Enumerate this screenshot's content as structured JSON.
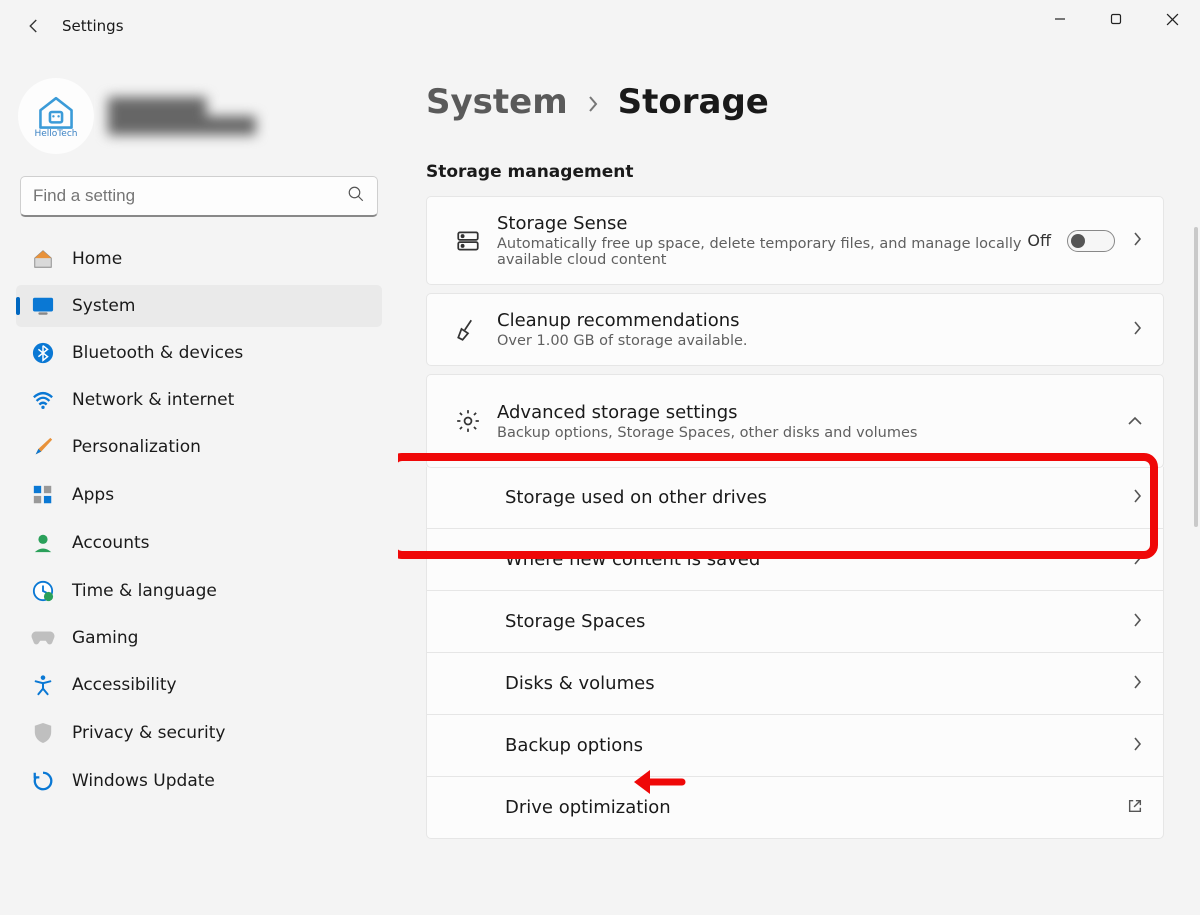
{
  "app": {
    "title": "Settings"
  },
  "profile": {
    "avatar_caption": "HelloTech"
  },
  "search": {
    "placeholder": "Find a setting"
  },
  "sidebar": {
    "items": [
      {
        "id": "home",
        "label": "Home"
      },
      {
        "id": "system",
        "label": "System",
        "active": true
      },
      {
        "id": "bluetooth",
        "label": "Bluetooth & devices"
      },
      {
        "id": "network",
        "label": "Network & internet"
      },
      {
        "id": "personalization",
        "label": "Personalization"
      },
      {
        "id": "apps",
        "label": "Apps"
      },
      {
        "id": "accounts",
        "label": "Accounts"
      },
      {
        "id": "time",
        "label": "Time & language"
      },
      {
        "id": "gaming",
        "label": "Gaming"
      },
      {
        "id": "accessibility",
        "label": "Accessibility"
      },
      {
        "id": "privacy",
        "label": "Privacy & security"
      },
      {
        "id": "update",
        "label": "Windows Update"
      }
    ]
  },
  "breadcrumb": {
    "parent": "System",
    "current": "Storage"
  },
  "main": {
    "section_label": "Storage management",
    "storage_sense": {
      "title": "Storage Sense",
      "subtitle": "Automatically free up space, delete temporary files, and manage locally available cloud content",
      "state_label": "Off"
    },
    "cleanup": {
      "title": "Cleanup recommendations",
      "subtitle": "Over 1.00 GB of storage available."
    },
    "advanced": {
      "title": "Advanced storage settings",
      "subtitle": "Backup options, Storage Spaces, other disks and volumes",
      "items": [
        {
          "label": "Storage used on other drives"
        },
        {
          "label": "Where new content is saved"
        },
        {
          "label": "Storage Spaces"
        },
        {
          "label": "Disks & volumes"
        },
        {
          "label": "Backup options"
        },
        {
          "label": "Drive optimization",
          "external": true
        }
      ]
    }
  }
}
